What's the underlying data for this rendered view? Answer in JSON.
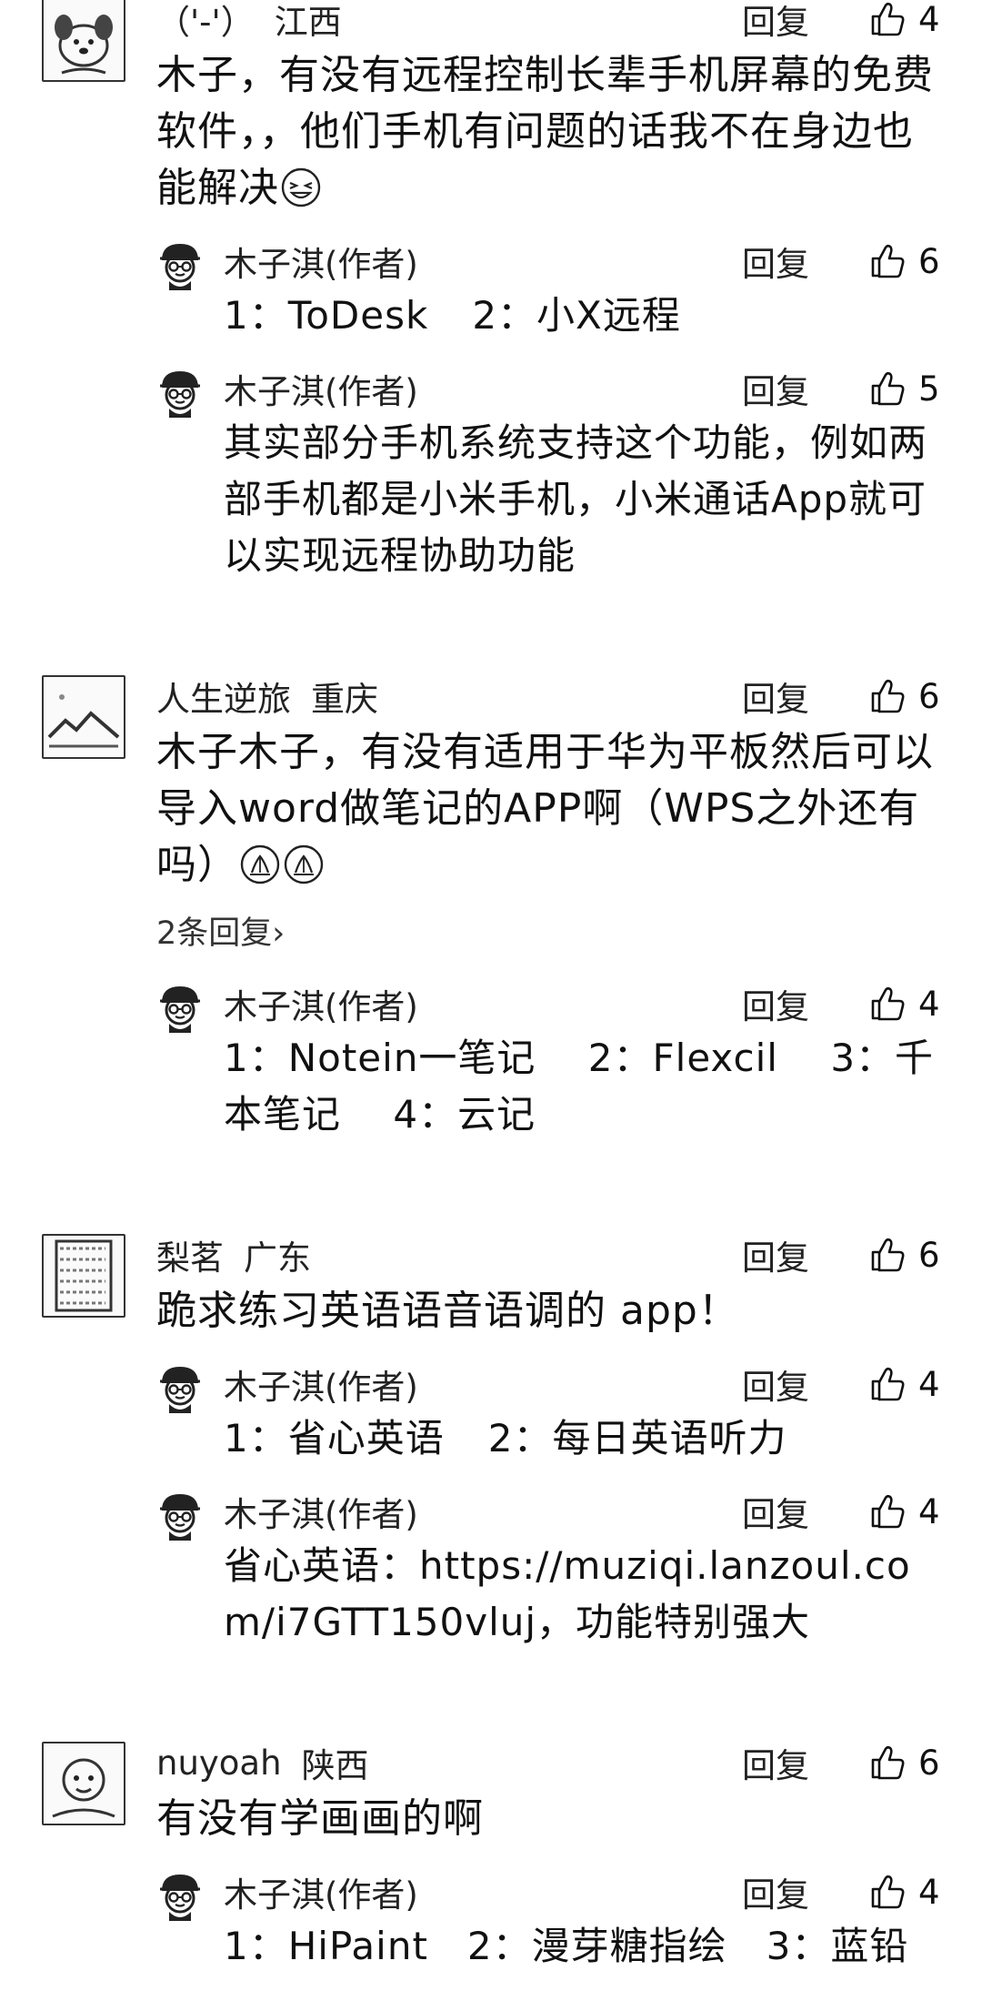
{
  "reply_label": "回复",
  "comments": [
    {
      "user": "（'-'）",
      "location": "江西",
      "likes": "4",
      "text": "木子，有没有远程控制长辈手机屏幕的免费软件，，他们手机有问题的话我不在身边也能解决",
      "emoji": "laughing-face-emoji",
      "replies": [
        {
          "user": "木子淇(作者)",
          "likes": "6",
          "options": [
            "1：ToDesk",
            "2：小X远程"
          ]
        },
        {
          "user": "木子淇(作者)",
          "likes": "5",
          "text": "其实部分手机系统支持这个功能，例如两部手机都是小米手机，小米通话App就可以实现远程协助功能"
        }
      ]
    },
    {
      "user": "人生逆旅",
      "location": "重庆",
      "likes": "6",
      "text": "木子木子，有没有适用于华为平板然后可以导入word做笔记的APP啊（WPS之外还有吗）",
      "emoji": "praying-hands-emoji",
      "more_replies": "2条回复",
      "replies": [
        {
          "user": "木子淇(作者)",
          "likes": "4",
          "text": "1：Notein一笔记　 2：Flexcil　 3：千本笔记　 4：云记"
        }
      ]
    },
    {
      "user": "梨茗",
      "location": "广东",
      "likes": "6",
      "text": "跪求练习英语语音语调的 app！",
      "replies": [
        {
          "user": "木子淇(作者)",
          "likes": "4",
          "options": [
            "1：省心英语",
            "2：每日英语听力"
          ]
        },
        {
          "user": "木子淇(作者)",
          "likes": "4",
          "text": "省心英语：https://muziqi.lanzoul.com/i7GTT150vluj，功能特别强大"
        }
      ]
    },
    {
      "user": "nuyoah",
      "location": "陕西",
      "likes": "6",
      "text": "有没有学画画的啊",
      "replies": [
        {
          "user": "木子淇(作者)",
          "likes": "4",
          "text": "1：HiPaint　2：漫芽糖指绘　3：蓝铅"
        }
      ]
    }
  ]
}
